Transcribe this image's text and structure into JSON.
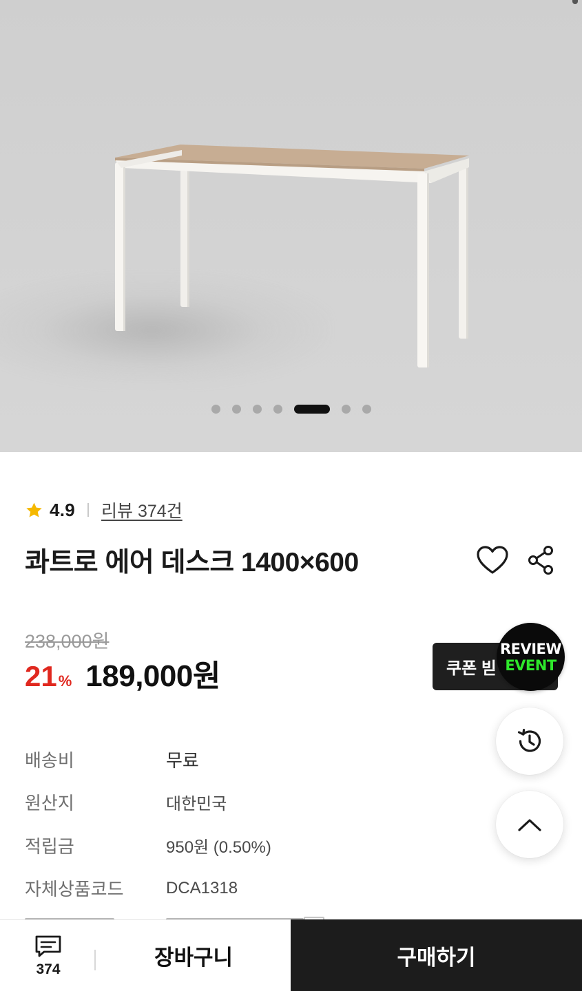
{
  "gallery": {
    "image_alt": "",
    "slide_count": 7,
    "active_index": 4
  },
  "rating": {
    "score": "4.9",
    "review_link": "리뷰 374건"
  },
  "product": {
    "title": "콰트로 에어 데스크 1400×600"
  },
  "price": {
    "original": "238,000원",
    "discount": "21",
    "discount_unit": "%",
    "sale": "189,000원"
  },
  "coupon": {
    "label": "쿠폰 빋"
  },
  "review_event": {
    "line1": "REVIEW",
    "line2": "EVENT",
    "line2_color": "#2ee82b"
  },
  "info": [
    {
      "label": "배송비",
      "value": "무료"
    },
    {
      "label": "원산지",
      "value": "대한민국"
    },
    {
      "label": "적립금",
      "value": "950원 (0.50%)"
    },
    {
      "label": "자체상품코드",
      "value": "DCA1318"
    }
  ],
  "bottom_bar": {
    "chat_count": "374",
    "cart_label": "장바구니",
    "buy_label": "구매하기"
  },
  "icons": {
    "star": "star-icon",
    "heart": "heart-icon",
    "share": "share-icon",
    "history": "history-icon",
    "up": "chevron-up-icon",
    "chat": "chat-icon"
  },
  "colors": {
    "discount": "#e0281f",
    "star": "#f5b800",
    "buy_button": "#1c1c1c",
    "coupon_chip": "#1f1f1f"
  }
}
